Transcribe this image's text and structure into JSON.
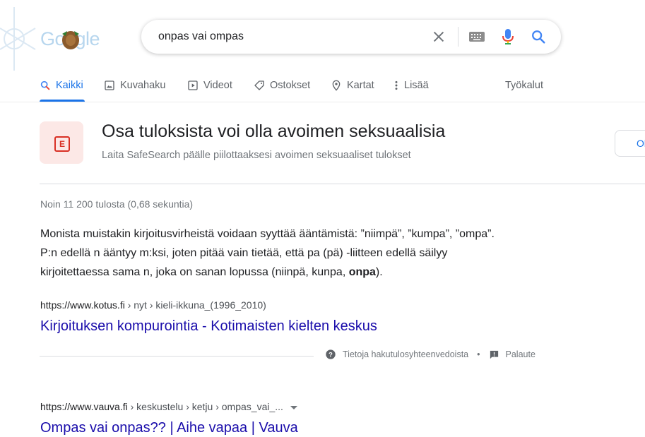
{
  "logo": {
    "text": "Google"
  },
  "search": {
    "query": "onpas vai ompas"
  },
  "tabs": [
    {
      "label": "Kaikki",
      "icon": "search-icon",
      "active": true
    },
    {
      "label": "Kuvahaku",
      "icon": "image-icon"
    },
    {
      "label": "Videot",
      "icon": "video-icon"
    },
    {
      "label": "Ostokset",
      "icon": "tag-icon"
    },
    {
      "label": "Kartat",
      "icon": "map-pin-icon"
    },
    {
      "label": "Lisää",
      "icon": "more-vert-icon"
    }
  ],
  "tools_label": "Työkalut",
  "safesearch": {
    "badge_letter": "E",
    "title": "Osa tuloksista voi olla avoimen seksuaalisia",
    "subtitle": "Laita SafeSearch päälle piilottaaksesi avoimen seksuaaliset tulokset",
    "button_label": "Ol"
  },
  "stats": "Noin 11 200 tulosta (0,68 sekuntia)",
  "featured_snippet": {
    "line1": "Monista muistakin kirjoitusvirheistä voidaan syyttää ääntämistä: ”niimpä”, ”kumpa”, ”ompa”.",
    "line2": "P:n edellä n ääntyy m:ksi, joten pitää vain tietää, että pa (pä) -liitteen edellä säilyy",
    "line3_before": "kirjoitettaessa sama n, joka on sanan lopussa (niinpä, kunpa, ",
    "line3_bold": "onpa",
    "line3_after": ")."
  },
  "result1": {
    "host": "https://www.kotus.fi",
    "path": " › nyt › kieli-ikkuna_(1996_2010)",
    "title": "Kirjoituksen kompurointia - Kotimaisten kielten keskus"
  },
  "feedback": {
    "about": "Tietoja hakutulosyhteenvedoista",
    "separator": "•",
    "feedback": "Palaute"
  },
  "result2": {
    "host": "https://www.vauva.fi",
    "path": " › keskustelu › ketju › ompas_vai_...",
    "title": "Ompas vai onpas?? | Aihe vapaa | Vauva"
  },
  "colors": {
    "accent": "#1a73e8",
    "link": "#1a0dab",
    "safesearch_red": "#d93025"
  }
}
